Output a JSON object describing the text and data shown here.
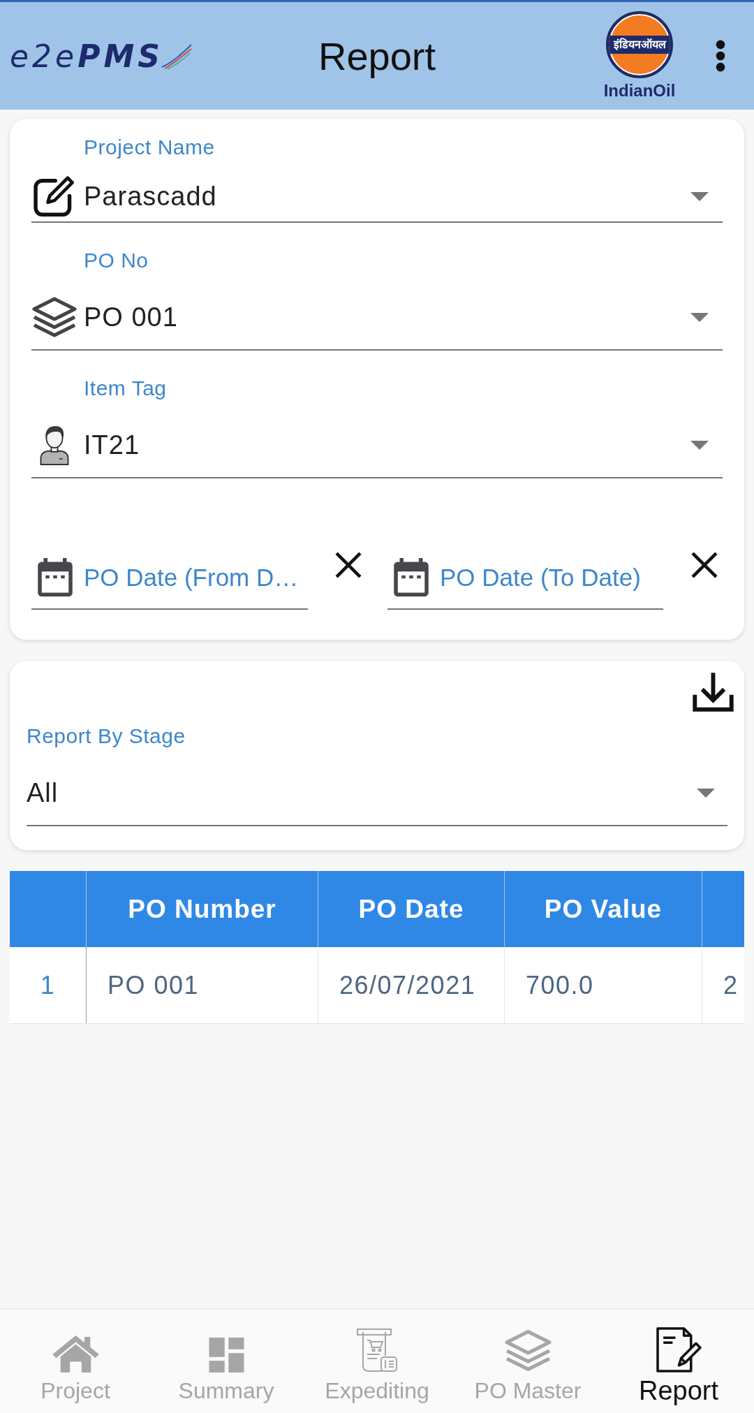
{
  "app_bar": {
    "logo": "e2e**PMS**",
    "title": "Report",
    "brand": {
      "band_text": "इंडियनऑयल",
      "name": "IndianOil"
    }
  },
  "filters": {
    "dropdowns": [
      {
        "label": "Project Name",
        "value": "Parascadd"
      },
      {
        "label": "PO No",
        "value": "PO 001"
      },
      {
        "label": "Item Tag",
        "value": "IT21"
      }
    ],
    "date_fields": [
      {
        "placeholder": "PO Date (From D…"
      },
      {
        "placeholder": "PO Date (To Date)"
      }
    ]
  },
  "report": {
    "stage_field": {
      "label": "Report By Stage",
      "value": "All"
    }
  },
  "table": {
    "columns": [
      {
        "kind": "index"
      },
      {
        "kind": "text",
        "label": "PO Number"
      },
      {
        "kind": "text",
        "label": "PO Date"
      },
      {
        "kind": "text",
        "label": "PO Value"
      },
      {
        "kind": "text"
      }
    ],
    "rows": [
      [
        "1",
        "PO 001",
        "26/07/2021",
        "700.0",
        "2"
      ]
    ]
  },
  "bottom_nav": {
    "items": [
      {
        "label": "Project",
        "selected": false
      },
      {
        "label": "Summary",
        "selected": false
      },
      {
        "label": "Expediting",
        "selected": false
      },
      {
        "label": "PO Master",
        "selected": false
      },
      {
        "label": "Report",
        "selected": true
      }
    ]
  }
}
